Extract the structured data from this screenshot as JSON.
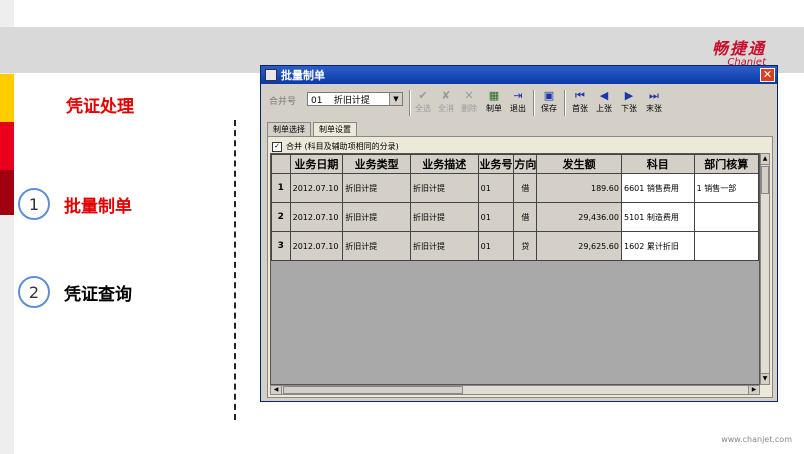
{
  "slide": {
    "section_title": "凭证处理",
    "steps": [
      {
        "num": "1",
        "label": "批量制单",
        "color": "#e30000"
      },
      {
        "num": "2",
        "label": "凭证查询",
        "color": "#000000"
      }
    ],
    "brand_zh": "畅捷通",
    "brand_en": "Chanjet",
    "footer_url": "www.chanjet.com"
  },
  "colors": {
    "accent": "#e30000",
    "titlebar": "#0a3aa8",
    "circle_border": "#5b8fd6"
  },
  "window": {
    "title": "批量制单",
    "close_glyph": "✕",
    "toolbar": {
      "merge_label": "合并号",
      "merge_value": "01    折旧计提",
      "buttons": [
        {
          "label": "全选",
          "icon": "select-all-icon",
          "glyph": "✔",
          "disabled": true
        },
        {
          "label": "全消",
          "icon": "deselect-all-icon",
          "glyph": "✘",
          "disabled": true
        },
        {
          "label": "删除",
          "icon": "delete-icon",
          "glyph": "✕",
          "disabled": true
        },
        {
          "label": "制单",
          "icon": "make-voucher-icon",
          "glyph": "▦",
          "disabled": false
        },
        {
          "label": "退出",
          "icon": "exit-icon",
          "glyph": "⇥",
          "disabled": false
        },
        {
          "label": "保存",
          "icon": "save-icon",
          "glyph": "▣",
          "disabled": false
        },
        {
          "label": "首张",
          "icon": "first-icon",
          "glyph": "⏮",
          "disabled": false
        },
        {
          "label": "上张",
          "icon": "prev-icon",
          "glyph": "◀",
          "disabled": false
        },
        {
          "label": "下张",
          "icon": "next-icon",
          "glyph": "▶",
          "disabled": false
        },
        {
          "label": "末张",
          "icon": "last-icon",
          "glyph": "⏭",
          "disabled": false
        }
      ]
    },
    "tabs": [
      {
        "label": "制单选择",
        "active": false
      },
      {
        "label": "制单设置",
        "active": true
      }
    ],
    "merge_checkbox": {
      "label": "合并 (科目及辅助项相同的分录)",
      "checked": true,
      "glyph": "✓"
    },
    "table": {
      "columns": [
        "",
        "业务日期",
        "业务类型",
        "业务描述",
        "业务号",
        "方向",
        "发生额",
        "科目",
        "部门核算"
      ],
      "rows": [
        {
          "n": "1",
          "date": "2012.07.10",
          "type": "折旧计提",
          "desc": "折旧计提",
          "no": "01",
          "dir": "借",
          "amount": "189.60",
          "subject": "6601   销售费用",
          "dept": "1   销售一部"
        },
        {
          "n": "2",
          "date": "2012.07.10",
          "type": "折旧计提",
          "desc": "折旧计提",
          "no": "01",
          "dir": "借",
          "amount": "29,436.00",
          "subject": "5101   制造费用",
          "dept": ""
        },
        {
          "n": "3",
          "date": "2012.07.10",
          "type": "折旧计提",
          "desc": "折旧计提",
          "no": "01",
          "dir": "贷",
          "amount": "29,625.60",
          "subject": "1602   累计折旧",
          "dept": ""
        }
      ]
    }
  }
}
